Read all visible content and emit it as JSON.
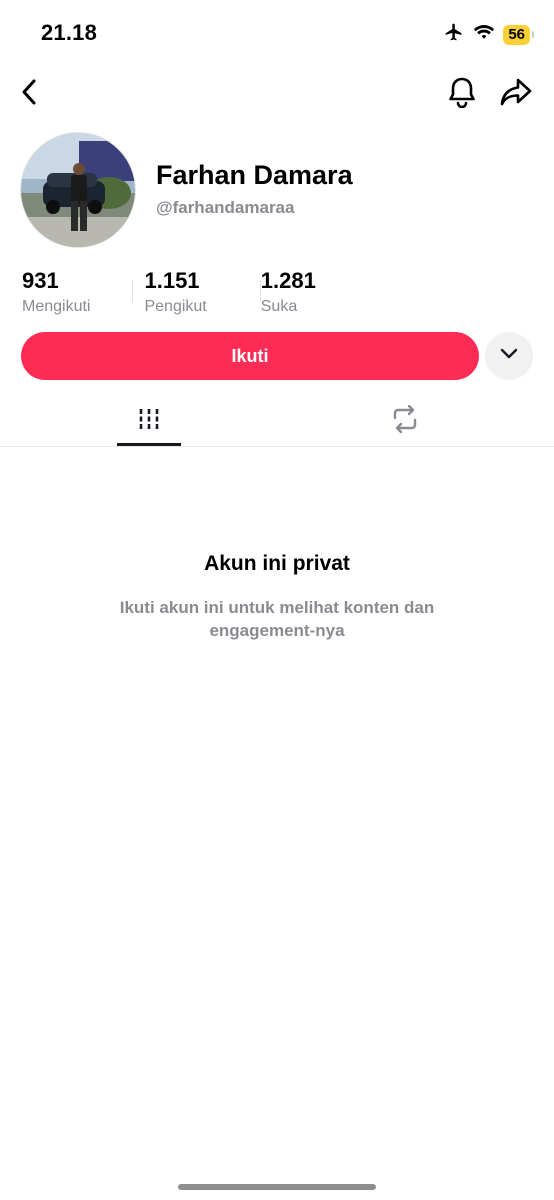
{
  "status_bar": {
    "time": "21.18",
    "battery_level": "56",
    "icons": [
      "airplane-icon",
      "wifi-icon",
      "battery-icon"
    ]
  },
  "nav": {
    "icons": [
      "back-icon",
      "bell-icon",
      "share-icon"
    ]
  },
  "profile": {
    "display_name": "Farhan Damara",
    "username": "@farhandamaraa"
  },
  "stats": [
    {
      "value": "931",
      "label": "Mengikuti"
    },
    {
      "value": "1.151",
      "label": "Pengikut"
    },
    {
      "value": "1.281",
      "label": "Suka"
    }
  ],
  "actions": {
    "follow_label": "Ikuti",
    "more_icon": "chevron-down-icon"
  },
  "tabs": [
    {
      "icon": "grid-icon",
      "active": true
    },
    {
      "icon": "repost-icon",
      "active": false
    }
  ],
  "private_notice": {
    "title": "Akun ini privat",
    "description": "Ikuti akun ini untuk melihat konten dan engagement-nya"
  },
  "colors": {
    "accent": "#fe2c55",
    "battery": "#f7d038",
    "secondary_text": "#8a8b91"
  }
}
